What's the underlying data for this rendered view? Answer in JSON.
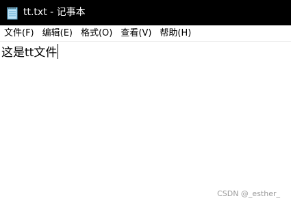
{
  "window": {
    "title": "tt.txt - 记事本",
    "icon": "notepad-icon"
  },
  "menubar": {
    "items": [
      {
        "label": "文件(F)"
      },
      {
        "label": "编辑(E)"
      },
      {
        "label": "格式(O)"
      },
      {
        "label": "查看(V)"
      },
      {
        "label": "帮助(H)"
      }
    ]
  },
  "editor": {
    "content": "这是tt文件"
  },
  "watermark": {
    "text": "CSDN @_esther_"
  },
  "colors": {
    "titlebar_bg": "#000000",
    "titlebar_text": "#ffffff",
    "watermark": "#9a9a9a"
  }
}
